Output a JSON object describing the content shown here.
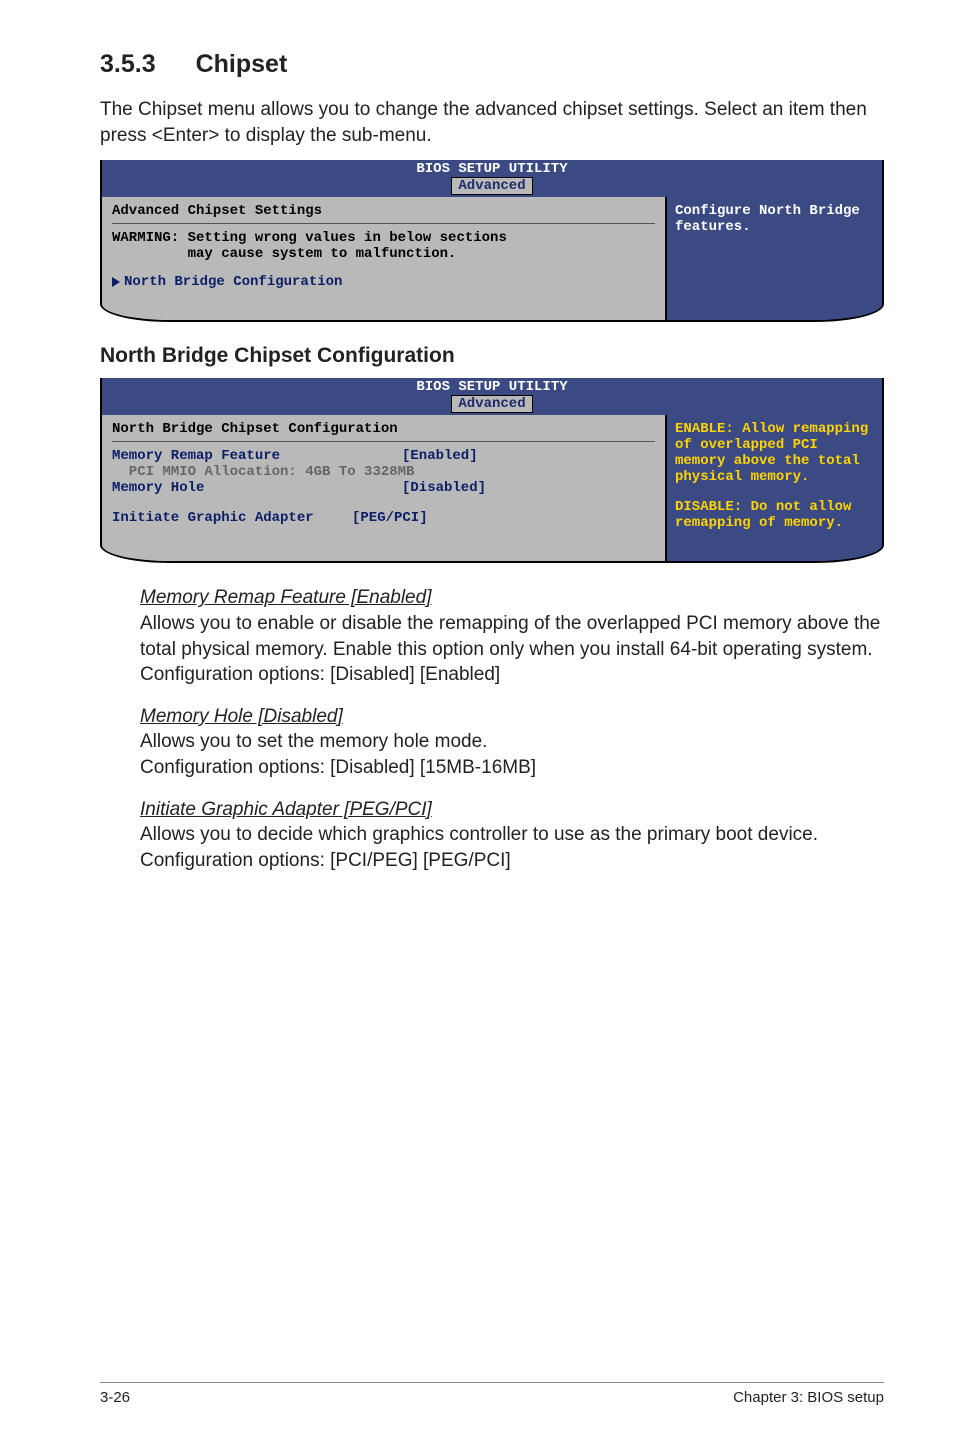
{
  "section": {
    "number": "3.5.3",
    "title": "Chipset"
  },
  "intro": "The Chipset menu allows you to change the advanced chipset settings. Select an item then press <Enter> to display the sub-menu.",
  "bios1": {
    "header": "BIOS SETUP UTILITY",
    "tab": "Advanced",
    "left_title": "Advanced Chipset Settings",
    "warn": "WARMING: Setting wrong values in below sections\n         may cause system to malfunction.",
    "nav": "North Bridge Configuration",
    "help": "Configure North Bridge features."
  },
  "subhead": "North Bridge Chipset Configuration",
  "bios2": {
    "header": "BIOS SETUP UTILITY",
    "tab": "Advanced",
    "left_title": "North Bridge Chipset Configuration",
    "rows": {
      "r1k": "Memory Remap Feature",
      "r1v": "[Enabled]",
      "pci": "  PCI MMIO Allocation: 4GB To 3328MB",
      "r2k": "Memory Hole",
      "r2v": "[Disabled]",
      "r3k": "Initiate Graphic Adapter",
      "r3v": "[PEG/PCI]"
    },
    "help1_head": "ENABLE: Allow",
    "help1_body": "remapping of overlapped PCI memory above the total physical memory.",
    "help2_head": "DISABLE: Do not allow",
    "help2_body": "remapping of memory."
  },
  "entries": {
    "e1": {
      "title": "Memory Remap Feature [Enabled]",
      "body": "Allows you to enable or disable the remapping of the overlapped PCI memory above the total physical memory. Enable this option only when you install 64-bit operating system.",
      "opts": "Configuration options: [Disabled] [Enabled]"
    },
    "e2": {
      "title": "Memory Hole [Disabled]",
      "body": "Allows you to set the memory hole mode.",
      "opts": "Configuration options: [Disabled] [15MB-16MB]"
    },
    "e3": {
      "title": "Initiate Graphic Adapter [PEG/PCI]",
      "body": "Allows you to decide which graphics controller to use as the primary boot device.",
      "opts": "Configuration options: [PCI/PEG] [PEG/PCI]"
    }
  },
  "footer": {
    "left": "3-26",
    "right": "Chapter 3: BIOS setup"
  }
}
